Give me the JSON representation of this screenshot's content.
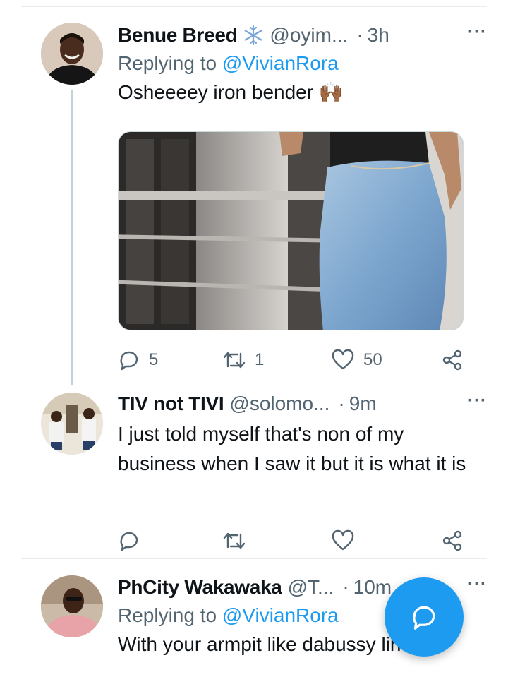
{
  "tweets": [
    {
      "name": "Benue Breed",
      "handle": "@oyim...",
      "dot": "·",
      "time": "3h",
      "more": "···",
      "reply_prefix": "Replying to",
      "reply_to": "@VivianRora",
      "text": "Osheeeey iron bender 🙌🏾",
      "stats": {
        "replies": "5",
        "retweets": "1",
        "likes": "50"
      }
    },
    {
      "name": "TIV not TIVI",
      "handle": "@solomo...",
      "dot": "·",
      "time": "9m",
      "more": "···",
      "text": "I just told myself that's non of my business when I saw it but it is what it is",
      "stats": {
        "replies": "",
        "retweets": "",
        "likes": ""
      }
    },
    {
      "name": "PhCity Wakawaka",
      "handle": "@T...",
      "dot": "·",
      "time": "10m",
      "more": "···",
      "reply_prefix": "Replying to",
      "reply_to": "@VivianRora",
      "text": "With your armpit like dabussy line"
    }
  ],
  "icons": {
    "verified": "snowflake-icon",
    "reply": "reply-icon",
    "retweet": "retweet-icon",
    "like": "heart-icon",
    "share": "share-icon",
    "compose": "compose-reply-icon"
  },
  "colors": {
    "accent": "#1d9bf0",
    "secondary_text": "#536471",
    "thread_line": "#c4cfd6",
    "verified": "#7aa7d9"
  }
}
